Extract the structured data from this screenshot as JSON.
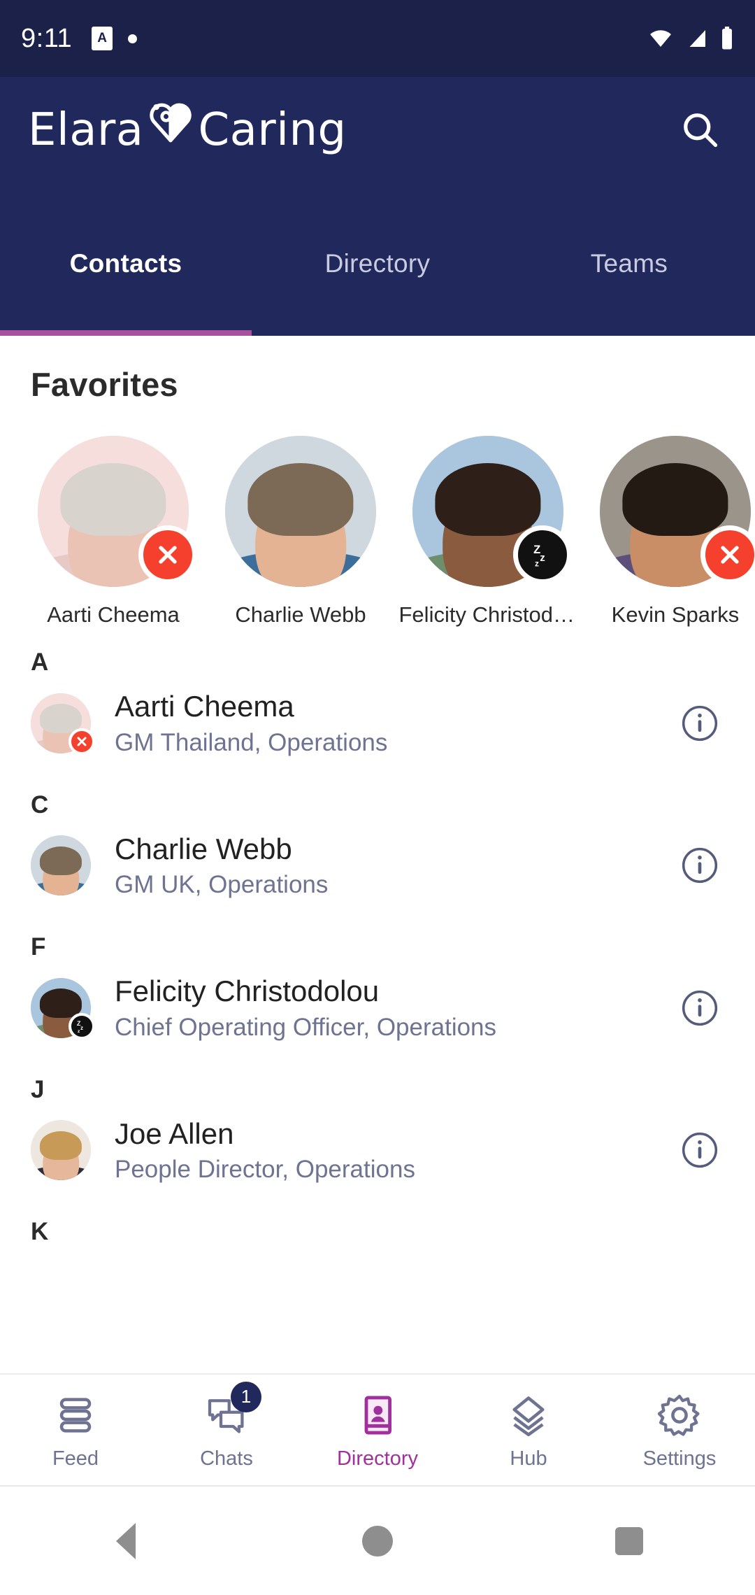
{
  "status_bar": {
    "time": "9:11",
    "app_icon_label": "A",
    "icons": [
      "app-notification-icon",
      "dot-icon",
      "wifi-icon",
      "cellular-signal-icon",
      "battery-icon"
    ]
  },
  "header": {
    "logo_first": "Elara",
    "logo_second": "Caring",
    "logo_glyph": "heart-stethoscope-icon",
    "search_icon": "search-icon",
    "background_color": "#21295C"
  },
  "tabs": {
    "items": [
      {
        "label": "Contacts",
        "active": true
      },
      {
        "label": "Directory",
        "active": false
      },
      {
        "label": "Teams",
        "active": false
      }
    ],
    "active_indicator_color": "#A94FA0"
  },
  "favorites": {
    "title": "Favorites",
    "people": [
      {
        "name": "Aarti Cheema",
        "status": "dnd",
        "status_icon": "close-x-icon"
      },
      {
        "name": "Charlie Webb",
        "status": "none",
        "status_icon": ""
      },
      {
        "name": "Felicity Christodol…",
        "status": "away",
        "status_icon": "zzz-icon"
      },
      {
        "name": "Kevin Sparks",
        "status": "dnd",
        "status_icon": "close-x-icon"
      }
    ]
  },
  "contacts": {
    "info_icon": "info-icon",
    "groups": [
      {
        "letter": "A",
        "people": [
          {
            "name": "Aarti Cheema",
            "role": "GM Thailand, Operations",
            "status": "dnd",
            "status_icon": "close-x-icon"
          }
        ]
      },
      {
        "letter": "C",
        "people": [
          {
            "name": "Charlie Webb",
            "role": "GM UK, Operations",
            "status": "none",
            "status_icon": ""
          }
        ]
      },
      {
        "letter": "F",
        "people": [
          {
            "name": "Felicity Christodolou",
            "role": "Chief Operating Officer, Operations",
            "status": "away",
            "status_icon": "zzz-icon"
          }
        ]
      },
      {
        "letter": "J",
        "people": [
          {
            "name": "Joe Allen",
            "role": "People Director, Operations",
            "status": "none",
            "status_icon": ""
          }
        ]
      },
      {
        "letter": "K",
        "people": []
      }
    ]
  },
  "bottom_nav": {
    "items": [
      {
        "label": "Feed",
        "icon": "feed-icon",
        "active": false,
        "badge": ""
      },
      {
        "label": "Chats",
        "icon": "chats-icon",
        "active": false,
        "badge": "1"
      },
      {
        "label": "Directory",
        "icon": "directory-icon",
        "active": true,
        "badge": ""
      },
      {
        "label": "Hub",
        "icon": "hub-icon",
        "active": false,
        "badge": ""
      },
      {
        "label": "Settings",
        "icon": "settings-gear-icon",
        "active": false,
        "badge": ""
      }
    ],
    "active_color": "#A0309B",
    "inactive_color": "#6E7391"
  },
  "android_nav": {
    "back": "back-triangle-icon",
    "home": "home-circle-icon",
    "recents": "recents-square-icon"
  }
}
